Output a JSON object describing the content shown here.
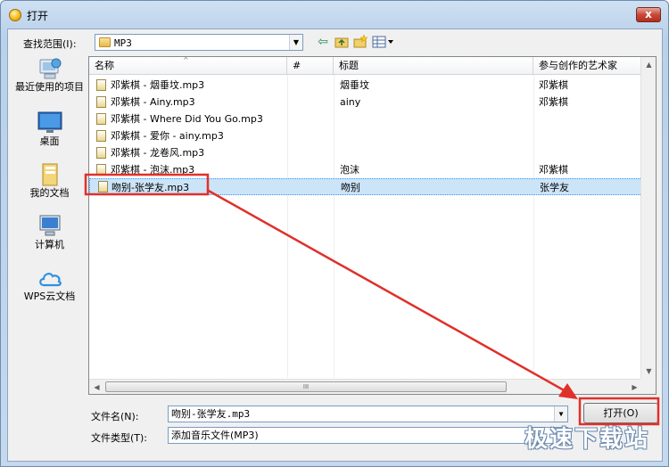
{
  "window": {
    "title": "打开",
    "close_glyph": "x"
  },
  "lookin": {
    "label": "查找范围(I):",
    "value": "MP3"
  },
  "places": [
    {
      "label": "最近使用的项目",
      "icon": "recent-places-icon"
    },
    {
      "label": "桌面",
      "icon": "desktop-icon"
    },
    {
      "label": "我的文档",
      "icon": "documents-icon"
    },
    {
      "label": "计算机",
      "icon": "computer-icon"
    },
    {
      "label": "WPS云文档",
      "icon": "wps-cloud-icon"
    }
  ],
  "columns": {
    "name": "名称",
    "number": "#",
    "title": "标题",
    "artist": "参与创作的艺术家"
  },
  "files": [
    {
      "name": "邓紫棋 - 烟垂坟.mp3",
      "title": "烟垂坟",
      "artist": "邓紫棋"
    },
    {
      "name": "邓紫棋 - Ainy.mp3",
      "title": "ainy",
      "artist": "邓紫棋"
    },
    {
      "name": "邓紫棋 - Where Did You Go.mp3",
      "title": "",
      "artist": ""
    },
    {
      "name": "邓紫棋 - 爱你 - ainy.mp3",
      "title": "",
      "artist": ""
    },
    {
      "name": "邓紫棋 - 龙卷风.mp3",
      "title": "",
      "artist": ""
    },
    {
      "name": "邓紫棋 - 泡沫.mp3",
      "title": "泡沫",
      "artist": "邓紫棋"
    },
    {
      "name": "吻别-张学友.mp3",
      "title": "吻别",
      "artist": "张学友"
    }
  ],
  "filename": {
    "label": "文件名(N):",
    "value": "吻别-张学友.mp3"
  },
  "filetype": {
    "label": "文件类型(T):",
    "value": "添加音乐文件(MP3)"
  },
  "buttons": {
    "open": "打开(O)"
  },
  "scroll_grip": "III",
  "watermark": "极速下载站",
  "colors": {
    "annotation_red": "#e0302a",
    "selection": "#cce4f7"
  }
}
